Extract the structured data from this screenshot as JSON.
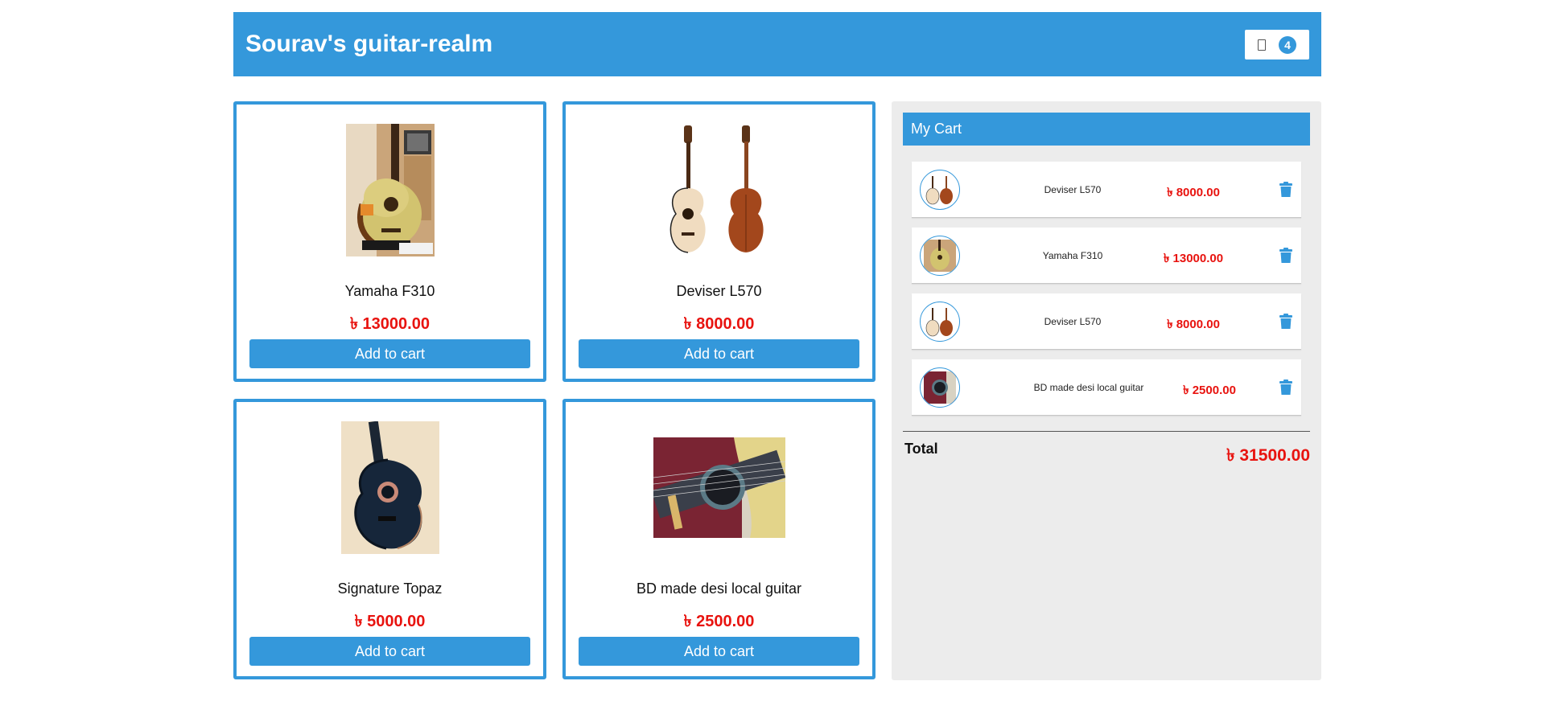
{
  "header": {
    "title": "Sourav's guitar-realm",
    "cart_count": "4"
  },
  "products": [
    {
      "name": "Yamaha F310",
      "price": "৳ 13000.00",
      "button": "Add to cart",
      "image": "acoustic-guitar-natural-on-stand"
    },
    {
      "name": "Deviser L570",
      "price": "৳ 8000.00",
      "button": "Add to cart",
      "image": "acoustic-guitar-front-and-back"
    },
    {
      "name": "Signature Topaz",
      "price": "৳ 5000.00",
      "button": "Add to cart",
      "image": "acoustic-guitar-blue"
    },
    {
      "name": "BD made desi local guitar",
      "price": "৳ 2500.00",
      "button": "Add to cart",
      "image": "guitar-soundhole-closeup-red"
    }
  ],
  "cart": {
    "title": "My Cart",
    "items": [
      {
        "name": "Deviser L570",
        "price": "৳ 8000.00",
        "image": "acoustic-guitar-front-and-back"
      },
      {
        "name": "Yamaha F310",
        "price": "৳ 13000.00",
        "image": "acoustic-guitar-natural-on-stand"
      },
      {
        "name": "Deviser L570",
        "price": "৳ 8000.00",
        "image": "acoustic-guitar-front-and-back"
      },
      {
        "name": "BD made desi local guitar",
        "price": "৳ 2500.00",
        "image": "guitar-soundhole-closeup-red"
      }
    ],
    "total_label": "Total",
    "total_value": "৳ 31500.00"
  },
  "colors": {
    "accent": "#3498db",
    "price": "#e8130f",
    "panel": "#ececec"
  },
  "icons": {
    "cart": "cart-icon",
    "delete": "trash-icon"
  }
}
